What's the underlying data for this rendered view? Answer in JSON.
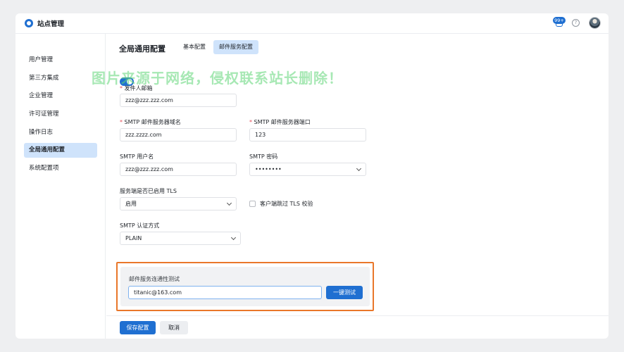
{
  "header": {
    "app_title": "站点管理",
    "notification_count": "99+",
    "help_icon": "help-circle-icon",
    "avatar": "user-avatar"
  },
  "sidebar": {
    "items": [
      {
        "label": "用户管理",
        "active": false
      },
      {
        "label": "第三方集成",
        "active": false
      },
      {
        "label": "企业管理",
        "active": false
      },
      {
        "label": "许可证管理",
        "active": false
      },
      {
        "label": "操作日志",
        "active": false
      },
      {
        "label": "全局通用配置",
        "active": true
      },
      {
        "label": "系统配置项",
        "active": false
      }
    ]
  },
  "main": {
    "page_title": "全局通用配置",
    "tabs": [
      {
        "label": "基本配置",
        "active": false
      },
      {
        "label": "邮件服务配置",
        "active": true
      }
    ],
    "mail_enabled": true,
    "form": {
      "sender_label": "发件人邮箱",
      "sender_value": "zzz@zzz.zzz.com",
      "smtp_domain_label": "SMTP 邮件服务器域名",
      "smtp_domain_value": "zzz.zzzz.com",
      "smtp_port_label": "SMTP 邮件服务器端口",
      "smtp_port_value": "123",
      "smtp_user_label": "SMTP 用户名",
      "smtp_user_value": "zzz@zzz.zzz.com",
      "smtp_password_label": "SMTP 密码",
      "smtp_password_value": "••••••••",
      "tls_label": "服务端是否已启用 TLS",
      "tls_value": "启用",
      "skip_tls_label": "客户端跳过 TLS 校验",
      "skip_tls_checked": false,
      "auth_label": "SMTP 认证方式",
      "auth_value": "PLAIN"
    },
    "test": {
      "title": "邮件服务连通性测试",
      "email_value": "titanic@163.com",
      "button_label": "一键测试"
    },
    "footer": {
      "save_label": "保存配置",
      "cancel_label": "取消"
    }
  },
  "watermark": "图片来源于网络，侵权联系站长删除！",
  "colors": {
    "accent": "#1f6fd1",
    "active_bg": "#cfe3fb",
    "highlight_border": "#e9772a",
    "required": "#e34d59"
  }
}
